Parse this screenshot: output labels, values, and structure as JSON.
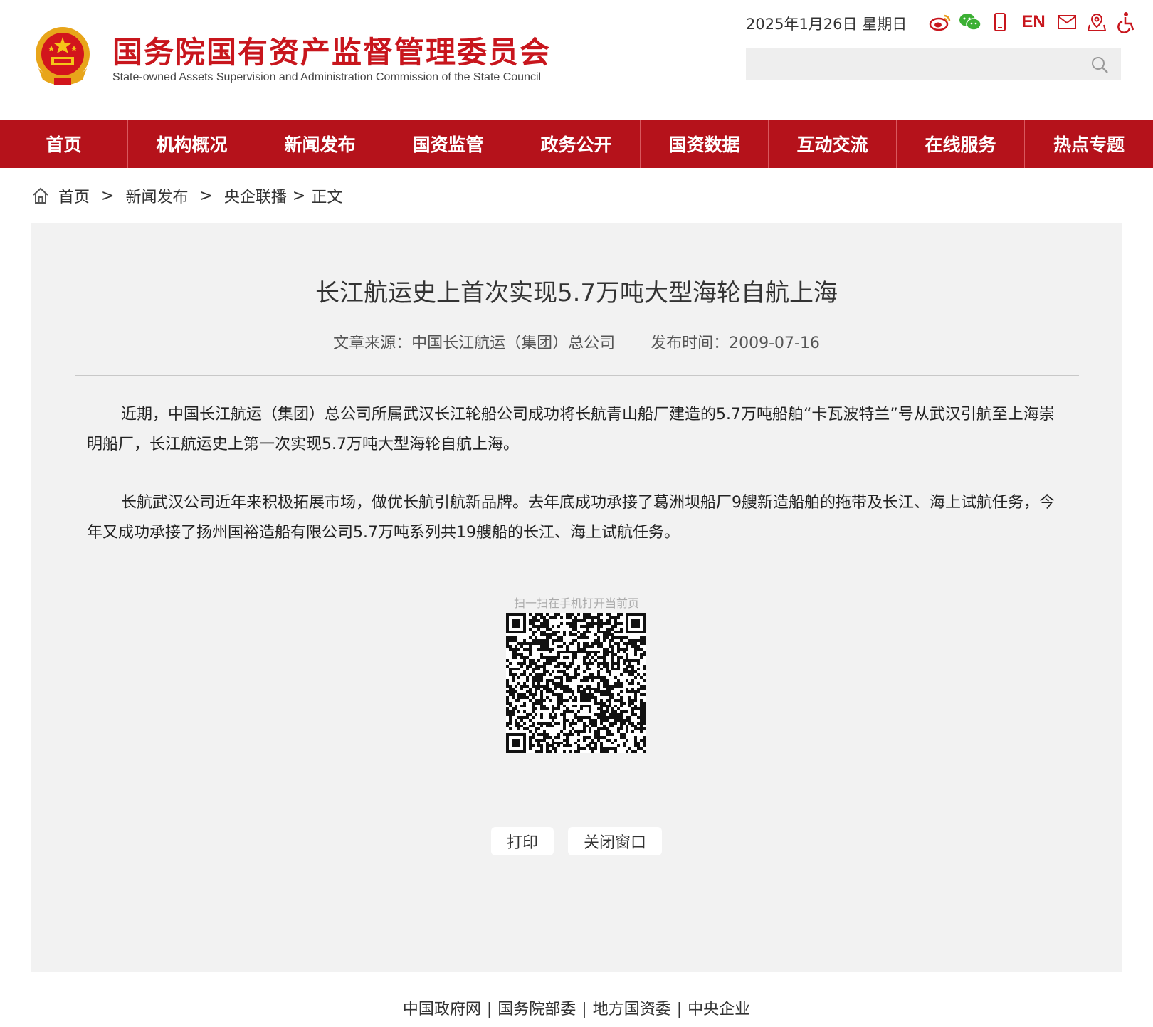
{
  "header": {
    "title_cn": "国务院国有资产监督管理委员会",
    "title_en": "State-owned Assets Supervision and Administration Commission of the State Council",
    "date": "2025年1月26日  星期日",
    "lang_label": "EN",
    "search_placeholder": ""
  },
  "icons": [
    "weibo-icon",
    "wechat-icon",
    "mobile-icon",
    "mail-icon",
    "map-icon",
    "accessibility-icon",
    "search-icon"
  ],
  "nav": {
    "items": [
      "首页",
      "机构概况",
      "新闻发布",
      "国资监管",
      "政务公开",
      "国资数据",
      "互动交流",
      "在线服务",
      "热点专题"
    ]
  },
  "breadcrumb": {
    "home": "首页",
    "sep": ">",
    "level1": "新闻发布",
    "level2": "央企联播",
    "level3": "正文"
  },
  "article": {
    "title": "长江航运史上首次实现5.7万吨大型海轮自航上海",
    "source": "文章来源：中国长江航运（集团）总公司",
    "published": "发布时间：2009-07-16",
    "paragraphs": [
      "近期，中国长江航运（集团）总公司所属武汉长江轮船公司成功将长航青山船厂建造的5.7万吨船舶“卡瓦波特兰”号从武汉引航至上海崇明船厂，长江航运史上第一次实现5.7万吨大型海轮自航上海。",
      "长航武汉公司近年来积极拓展市场，做优长航引航新品牌。去年底成功承接了葛洲坝船厂9艘新造船舶的拖带及长江、海上试航任务，今年又成功承接了扬州国裕造船有限公司5.7万吨系列共19艘船的长江、海上试航任务。"
    ],
    "qr_label": "扫一扫在手机打开当前页",
    "print_label": "打印",
    "close_label": "关闭窗口"
  },
  "footer": {
    "links": [
      "中国政府网",
      "国务院部委",
      "地方国资委",
      "中央企业"
    ],
    "sep": "|"
  },
  "colors": {
    "brand_red": "#c8161d",
    "nav_bg": "#b5121b",
    "content_bg": "#f2f2f2"
  }
}
